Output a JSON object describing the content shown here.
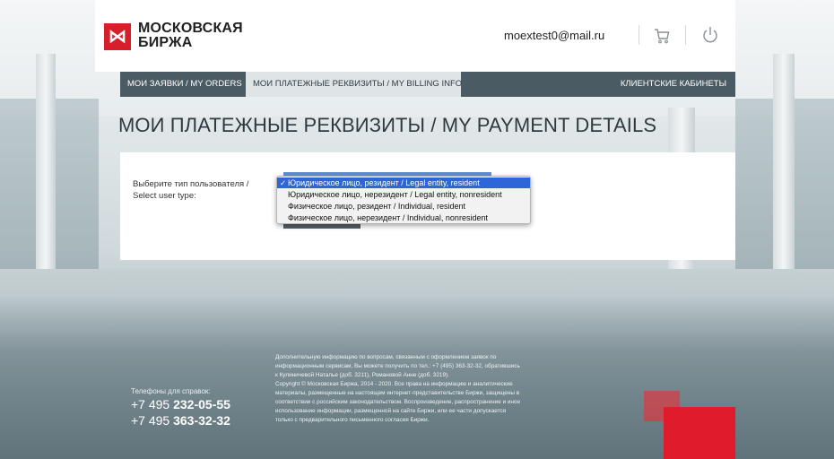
{
  "header": {
    "logo_line1": "МОСКОВСКАЯ",
    "logo_line2": "БИРЖА",
    "logo_mark": "⋈",
    "email": "moextest0@mail.ru",
    "cart_icon": "cart-icon",
    "power_icon": "power-icon",
    "brand_color": "#d71e2b"
  },
  "nav": {
    "items": [
      {
        "label": "МОИ ЗАЯВКИ / MY ORDERS"
      },
      {
        "label": "МОИ ПЛАТЕЖНЫЕ РЕКВИЗИТЫ / MY BILLING INFO"
      }
    ],
    "right_label": "КЛИЕНТСКИЕ КАБИНЕТЫ"
  },
  "page": {
    "title": "МОИ ПЛАТЕЖНЫЕ РЕКВИЗИТЫ / MY PAYMENT DETAILS"
  },
  "form": {
    "label_line1": "Выберите тип пользователя /",
    "label_line2": "Select user type:",
    "options": [
      {
        "label": "Юридическое лицо, резидент / Legal entity, resident",
        "selected": true
      },
      {
        "label": "Юридическое лицо, нерезидент / Legal entity, nonresident",
        "selected": false
      },
      {
        "label": "Физическое лицо, резидент / Individual, resident",
        "selected": false
      },
      {
        "label": "Физическое лицо, нерезидент / Individual, nonresident",
        "selected": false
      }
    ],
    "check_mark": "✓"
  },
  "footer": {
    "phones_label": "Телефоны для справок:",
    "phone1_prefix": "+7 495",
    "phone1_number": "232-05-55",
    "phone2_prefix": "+7 495",
    "phone2_number": "363-32-32",
    "info_lines": [
      "Дополнительную информацию по вопросам, связанным с оформлением заявок по",
      "информационным сервисам, Вы можете получить по тел.: +7 (495) 363-32-32, обратившись",
      "к Кулиничевой Наталье (доб. 3211), Романовой Анне (доб. 3219).",
      "Copyright © Московская Биржа, 2014 - 2020. Все права на информацию и аналитические",
      "материалы, размещенные на настоящем интернет-представительстве Биржи, защищены в",
      "соответствии с российским законодательством. Воспроизведение, распространение и иное",
      "использование информации, размещенной на сайте Биржи, или ее части допускается",
      "только с предварительного письменного согласия Биржи."
    ]
  }
}
